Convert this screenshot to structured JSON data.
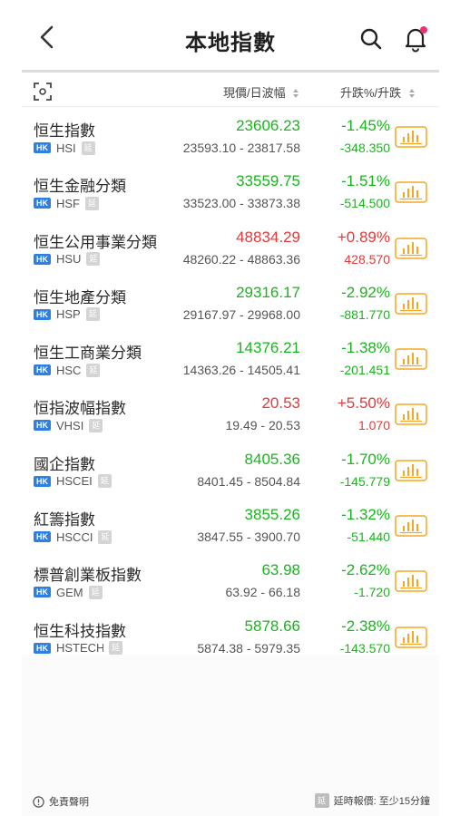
{
  "header": {
    "title": "本地指數"
  },
  "columns": {
    "price": "現價/日波幅",
    "change": "升跌%/升跌"
  },
  "rows": [
    {
      "name": "恒生指數",
      "market": "HK",
      "code": "HSI",
      "delay": "延",
      "price": "23606.23",
      "range": "23593.10 - 23817.58",
      "pct": "-1.45%",
      "chg": "-348.350",
      "dir": "down"
    },
    {
      "name": "恒生金融分類",
      "market": "HK",
      "code": "HSF",
      "delay": "延",
      "price": "33559.75",
      "range": "33523.00 - 33873.38",
      "pct": "-1.51%",
      "chg": "-514.500",
      "dir": "down"
    },
    {
      "name": "恒生公用事業分類",
      "market": "HK",
      "code": "HSU",
      "delay": "延",
      "price": "48834.29",
      "range": "48260.22 - 48863.36",
      "pct": "+0.89%",
      "chg": "428.570",
      "dir": "up"
    },
    {
      "name": "恒生地產分類",
      "market": "HK",
      "code": "HSP",
      "delay": "延",
      "price": "29316.17",
      "range": "29167.97 - 29968.00",
      "pct": "-2.92%",
      "chg": "-881.770",
      "dir": "down"
    },
    {
      "name": "恒生工商業分類",
      "market": "HK",
      "code": "HSC",
      "delay": "延",
      "price": "14376.21",
      "range": "14363.26 - 14505.41",
      "pct": "-1.38%",
      "chg": "-201.451",
      "dir": "down"
    },
    {
      "name": "恒指波幅指數",
      "market": "HK",
      "code": "VHSI",
      "delay": "延",
      "price": "20.53",
      "range": "19.49 - 20.53",
      "pct": "+5.50%",
      "chg": "1.070",
      "dir": "up"
    },
    {
      "name": "國企指數",
      "market": "HK",
      "code": "HSCEI",
      "delay": "延",
      "price": "8405.36",
      "range": "8401.45 - 8504.84",
      "pct": "-1.70%",
      "chg": "-145.779",
      "dir": "down"
    },
    {
      "name": "紅籌指數",
      "market": "HK",
      "code": "HSCCI",
      "delay": "延",
      "price": "3855.26",
      "range": "3847.55 - 3900.70",
      "pct": "-1.32%",
      "chg": "-51.440",
      "dir": "down"
    },
    {
      "name": "標普創業板指數",
      "market": "HK",
      "code": "GEM",
      "delay": "延",
      "price": "63.98",
      "range": "63.92 - 66.18",
      "pct": "-2.62%",
      "chg": "-1.720",
      "dir": "down"
    },
    {
      "name": "恒生科技指數",
      "market": "HK",
      "code": "HSTECH",
      "delay": "延",
      "price": "5878.66",
      "range": "5874.38 - 5979.35",
      "pct": "-2.38%",
      "chg": "-143.570",
      "dir": "down"
    }
  ],
  "colors": {
    "up": "#e13a3a",
    "down": "#19b51d",
    "accent": "#f5a623",
    "badge": "#2f7fe0",
    "notify_dot": "#e8336d"
  },
  "icons": {
    "back": "chevron-left-icon",
    "search": "search-icon",
    "bell": "bell-icon",
    "scan": "scan-icon",
    "chart": "bar-chart-icon",
    "info": "info-circle-icon"
  },
  "footer": {
    "disclaimer": "免責聲明",
    "delay_badge": "延",
    "delay_note": "延時報價: 至少15分鐘"
  }
}
